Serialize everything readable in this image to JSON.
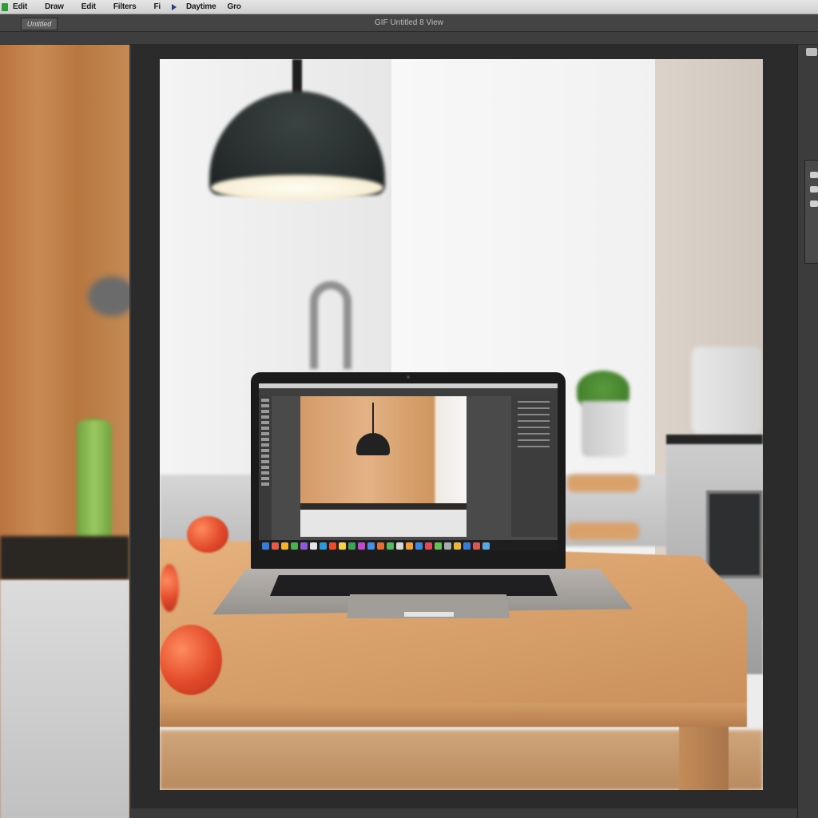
{
  "menubar": {
    "items": [
      "Edit",
      "Draw",
      "Edit",
      "Filters",
      "Fi",
      "Daytime",
      "Gro"
    ]
  },
  "document": {
    "tab_label": "Untitled",
    "title": "GIF Untitled 8 View"
  },
  "icons": {
    "app": "app-logo-icon",
    "play": "play-icon",
    "right_panel": [
      "dock-toggle-icon",
      "panel-icon",
      "panel-icon",
      "panel-icon"
    ]
  },
  "colors": {
    "menubar": "#d9d9d9",
    "workspace": "#3b3b3b",
    "canvas_border": "#2b2b2b"
  }
}
